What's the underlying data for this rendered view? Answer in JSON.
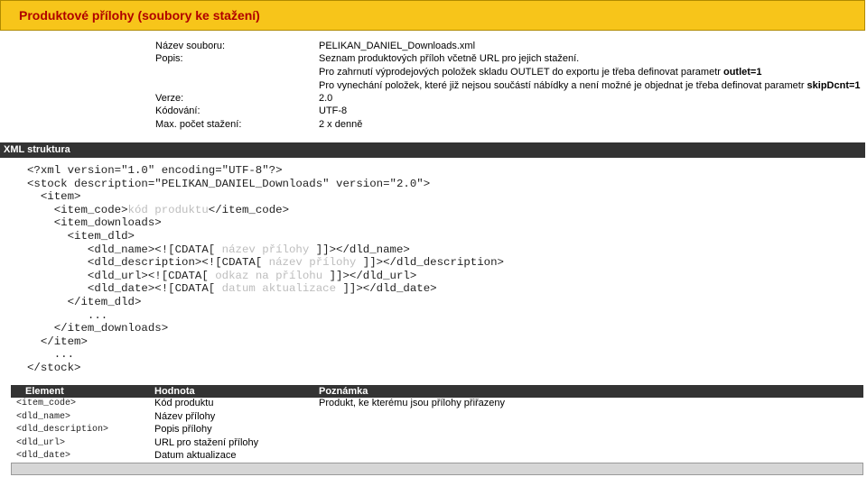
{
  "header": {
    "title": "Produktové přílohy (soubory ke stažení)"
  },
  "meta": {
    "filename_label": "Název souboru:",
    "filename": "PELIKAN_DANIEL_Downloads.xml",
    "description_label": "Popis:",
    "description_lines": [
      "Seznam produktových příloh včetně URL pro jejich stažení.",
      "Pro zahrnutí výprodejových položek skladu OUTLET do exportu je třeba definovat parametr ",
      "Pro vynechání položek, které již nejsou součástí nábídky a není možné je objednat je třeba definovat parametr "
    ],
    "param_outlet": "outlet=1",
    "param_skipdcnt": "skipDcnt=1",
    "version_label": "Verze:",
    "version": "2.0",
    "encoding_label": "Kódování:",
    "encoding": "UTF-8",
    "max_label": "Max. počet stažení:",
    "max": "2 x denně"
  },
  "xml_section": {
    "title": "XML struktura",
    "code": {
      "l1": "<?xml version=\"1.0\" encoding=\"UTF-8\"?>",
      "l2": "<stock description=\"PELIKAN_DANIEL_Downloads\" version=\"2.0\">",
      "l3": "  <item>",
      "l4a": "    <item_code>",
      "l4b": "kód produktu",
      "l4c": "</item_code>",
      "l5": "    <item_downloads>",
      "l6": "      <item_dld>",
      "l7a": "         <dld_name><![CDATA[",
      "l7b": " název přílohy ",
      "l7c": "]]></dld_name>",
      "l8a": "         <dld_description><![CDATA[",
      "l8b": " název přílohy ",
      "l8c": "]]></dld_description>",
      "l9a": "         <dld_url><![CDATA[",
      "l9b": " odkaz na přílohu ",
      "l9c": "]]></dld_url>",
      "l10a": "         <dld_date><![CDATA[",
      "l10b": " datum aktualizace ",
      "l10c": "]]></dld_date>",
      "l11": "      </item_dld>",
      "l12": "         ...",
      "l13": "    </item_downloads>",
      "l14": "  </item>",
      "l15": "    ...",
      "l16": "</stock>"
    }
  },
  "table": {
    "headers": [
      "Element",
      "Hodnota",
      "Poznámka"
    ],
    "rows": [
      {
        "element": "<item_code>",
        "value": "Kód produktu",
        "note": "Produkt, ke kterému jsou přílohy přiřazeny"
      },
      {
        "element": "<dld_name>",
        "value": "Název přílohy",
        "note": ""
      },
      {
        "element": "<dld_description>",
        "value": "Popis přílohy",
        "note": ""
      },
      {
        "element": "<dld_url>",
        "value": "URL pro stažení přílohy",
        "note": ""
      },
      {
        "element": "<dld_date>",
        "value": "Datum aktualizace",
        "note": ""
      }
    ]
  },
  "colors": {
    "title_bar": "#f7c51a",
    "title_text": "#b00000",
    "section_bar": "#333333",
    "placeholder_text": "#bdbdbd"
  }
}
